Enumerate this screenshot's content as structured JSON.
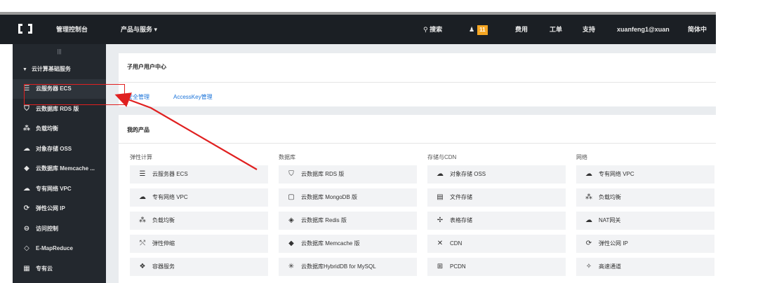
{
  "topbar": {
    "console_label": "管理控制台",
    "products_label": "产品与服务 ▾",
    "search_label": "搜索",
    "notification_count": "11",
    "billing_label": "费用",
    "ticket_label": "工单",
    "support_label": "支持",
    "user_label": "xuanfeng1@xuan",
    "more_label": "简体中"
  },
  "sidebar": {
    "collapse_glyph": "|||",
    "group_label": "云计算基础服务",
    "items": [
      {
        "label": "云服务器 ECS",
        "icon": "server-icon",
        "glyph": "☰"
      },
      {
        "label": "云数据库 RDS 版",
        "icon": "database-icon",
        "glyph": "⛉"
      },
      {
        "label": "负载均衡",
        "icon": "load-balancer-icon",
        "glyph": "⁂"
      },
      {
        "label": "对象存储 OSS",
        "icon": "cloud-storage-icon",
        "glyph": "☁"
      },
      {
        "label": "云数据库 Memcache ...",
        "icon": "memcache-icon",
        "glyph": "◆"
      },
      {
        "label": "专有网络 VPC",
        "icon": "vpc-icon",
        "glyph": "☁"
      },
      {
        "label": "弹性公网 IP",
        "icon": "elastic-ip-icon",
        "glyph": "⟳"
      },
      {
        "label": "访问控制",
        "icon": "access-control-icon",
        "glyph": "⊖"
      },
      {
        "label": "E-MapReduce",
        "icon": "emapreduce-icon",
        "glyph": "◇"
      },
      {
        "label": "专有云",
        "icon": "private-cloud-icon",
        "glyph": "▦"
      }
    ]
  },
  "subaccount": {
    "title": "子用户用户中心",
    "tabs": [
      "安全管理",
      "AccessKey管理"
    ]
  },
  "my_products": {
    "title": "我的产品",
    "columns": [
      {
        "heading": "弹性计算",
        "items": [
          {
            "label": "云服务器 ECS",
            "icon": "server-icon",
            "glyph": "☰"
          },
          {
            "label": "专有网络 VPC",
            "icon": "vpc-icon",
            "glyph": "☁"
          },
          {
            "label": "负载均衡",
            "icon": "load-balancer-icon",
            "glyph": "⁂"
          },
          {
            "label": "弹性伸缩",
            "icon": "auto-scaling-icon",
            "glyph": "⤲"
          },
          {
            "label": "容器服务",
            "icon": "container-icon",
            "glyph": "❖"
          }
        ]
      },
      {
        "heading": "数据库",
        "items": [
          {
            "label": "云数据库 RDS 版",
            "icon": "database-icon",
            "glyph": "⛉"
          },
          {
            "label": "云数据库 MongoDB 版",
            "icon": "mongodb-icon",
            "glyph": "▢"
          },
          {
            "label": "云数据库 Redis 版",
            "icon": "redis-icon",
            "glyph": "◈"
          },
          {
            "label": "云数据库 Memcache 版",
            "icon": "memcache-icon",
            "glyph": "◆"
          },
          {
            "label": "云数据库HybridDB for MySQL",
            "icon": "hybriddb-icon",
            "glyph": "✳"
          }
        ]
      },
      {
        "heading": "存储与CDN",
        "items": [
          {
            "label": "对象存储 OSS",
            "icon": "cloud-storage-icon",
            "glyph": "☁"
          },
          {
            "label": "文件存储",
            "icon": "file-storage-icon",
            "glyph": "▤"
          },
          {
            "label": "表格存储",
            "icon": "table-storage-icon",
            "glyph": "✢"
          },
          {
            "label": "CDN",
            "icon": "cdn-icon",
            "glyph": "✕"
          },
          {
            "label": "PCDN",
            "icon": "pcdn-icon",
            "glyph": "⊞"
          }
        ]
      },
      {
        "heading": "网络",
        "items": [
          {
            "label": "专有网络 VPC",
            "icon": "vpc-icon",
            "glyph": "☁"
          },
          {
            "label": "负载均衡",
            "icon": "load-balancer-icon",
            "glyph": "⁂"
          },
          {
            "label": "NAT网关",
            "icon": "nat-gateway-icon",
            "glyph": "☁"
          },
          {
            "label": "弹性公网 IP",
            "icon": "elastic-ip-icon",
            "glyph": "⟳"
          },
          {
            "label": "高速通道",
            "icon": "express-connect-icon",
            "glyph": "✧"
          }
        ]
      }
    ]
  },
  "colors": {
    "topbar_bg": "#1b1f24",
    "sidebar_bg": "#23282e",
    "link": "#1a73d9",
    "badge": "#f5a623",
    "annotation": "#e02020"
  }
}
